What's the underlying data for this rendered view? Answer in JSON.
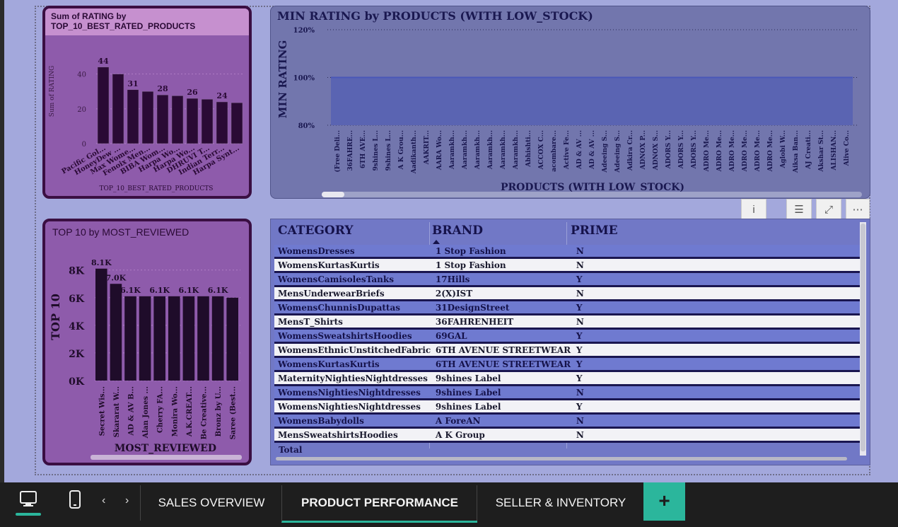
{
  "card1": {
    "title_line1": "Sum of RATING by",
    "title_line2": "TOP_10_BEST_RATED_PRODUCTS",
    "ylabel": "Sum of RATING",
    "xlabel": "TOP_10_BEST_RATED_PRODUCTS"
  },
  "card2": {
    "title": "MIN RATING by PRODUCTS (WITH LOW_STOCK)",
    "ylabel": "MIN RATING",
    "xlabel": "PRODUCTS (WITH LOW_STOCK)"
  },
  "card3": {
    "title": "TOP 10 by MOST_REVIEWED",
    "ylabel": "TOP 10",
    "xlabel": "MOST_REVIEWED"
  },
  "table": {
    "columns": [
      "CATEGORY",
      "BRAND",
      "PRIME"
    ],
    "rows": [
      [
        "WomensDresses",
        "1 Stop Fashion",
        "N"
      ],
      [
        "WomensKurtasKurtis",
        "1 Stop Fashion",
        "N"
      ],
      [
        "WomensCamisolesTanks",
        "17Hills",
        "Y"
      ],
      [
        "MensUnderwearBriefs",
        "2(X)IST",
        "N"
      ],
      [
        "WomensChunnisDupattas",
        "31DesignStreet",
        "Y"
      ],
      [
        "MensT_Shirts",
        "36FAHRENHEIT",
        "N"
      ],
      [
        "WomensSweatshirtsHoodies",
        "69GAL",
        "Y"
      ],
      [
        "WomensEthnicUnstitchedFabric",
        "6TH AVENUE STREETWEAR",
        "Y"
      ],
      [
        "WomensKurtasKurtis",
        "6TH AVENUE STREETWEAR",
        "Y"
      ],
      [
        "MaternityNightiesNightdresses",
        "9shines Label",
        "Y"
      ],
      [
        "WomensNightiesNightdresses",
        "9shines Label",
        "N"
      ],
      [
        "WomensNightiesNightdresses",
        "9shines Label",
        "Y"
      ],
      [
        "WomensBabydolls",
        "A ForeAN",
        "N"
      ],
      [
        "MensSweatshirtsHoodies",
        "A K Group",
        "N"
      ]
    ],
    "total_label": "Total"
  },
  "tabs": {
    "sales": "SALES OVERVIEW",
    "product": "PRODUCT PERFORMANCE",
    "seller": "SELLER & INVENTORY",
    "add": "+"
  },
  "chart_data": [
    {
      "type": "bar",
      "title": "Sum of RATING by TOP_10_BEST_RATED_PRODUCTS",
      "xlabel": "TOP_10_BEST_RATED_PRODUCTS",
      "ylabel": "Sum of RATING",
      "categories": [
        "Pacific Gol...",
        "HoneyDew ...",
        "Max Wome...",
        "Fenoix Men...",
        "BIBA Wom...",
        "Harpa Wo...",
        "Harpa Wo...",
        "DHRUVI T...",
        "Indian Terr...",
        "Harpa Synt..."
      ],
      "values": [
        44,
        40,
        31,
        30,
        28,
        27.5,
        26,
        25.5,
        24,
        23.5
      ],
      "data_labels": [
        "44",
        "",
        "31",
        "",
        "28",
        "",
        "26",
        "",
        "24",
        ""
      ],
      "ylim": [
        0,
        48
      ],
      "yticks": [
        "0",
        "20",
        "40"
      ],
      "bar_color": "#2a0a35"
    },
    {
      "type": "area",
      "title": "MIN RATING by PRODUCTS (WITH LOW_STOCK)",
      "xlabel": "PRODUCTS (WITH LOW_STOCK)",
      "ylabel": "MIN RATING",
      "categories": [
        "(Free Deli...",
        "36FAHRE...",
        "6TH AVE...",
        "9shines L...",
        "9shines L...",
        "A K Grou...",
        "Aadikanth...",
        "AAKRIT...",
        "AARA Wo...",
        "Aaramkh...",
        "Aaramkh...",
        "Aaramkh...",
        "Aaramkh...",
        "Aaramkh...",
        "Aaramkh...",
        "Abhishti...",
        "ACCOX C...",
        "acombare...",
        "Active Fe...",
        "AD & AV ...",
        "AD & AV ...",
        "Adeeing S...",
        "Adeeing S...",
        "Adkira Cr...",
        "ADNOX P...",
        "ADNOX S...",
        "ADORS Y...",
        "ADORS Y...",
        "ADORS Y...",
        "ADRO Me...",
        "ADRO Me...",
        "ADRO Me...",
        "ADRO Me...",
        "ADRO Me...",
        "ADRO Me...",
        "Aglobi W...",
        "Aiksa Ban...",
        "AJ Creati...",
        "Akshar St...",
        "ALISHAN...",
        "Alive Co..."
      ],
      "values": [
        100,
        100,
        100,
        100,
        100,
        100,
        100,
        100,
        100,
        100,
        100,
        100,
        100,
        100,
        100,
        100,
        100,
        100,
        100,
        100,
        100,
        100,
        100,
        100,
        100,
        100,
        100,
        100,
        100,
        100,
        100,
        100,
        100,
        100,
        100,
        100,
        100,
        100,
        100,
        100,
        100
      ],
      "yticks": [
        "80%",
        "100%",
        "120%"
      ],
      "ylim": [
        80,
        120
      ],
      "fill_color": "#5a64b2"
    },
    {
      "type": "bar",
      "title": "TOP 10 by MOST_REVIEWED",
      "xlabel": "MOST_REVIEWED",
      "ylabel": "TOP 10",
      "categories": [
        "Secret Wis...",
        "Skararat W...",
        "AD & AV B...",
        "Alan Jones ...",
        "Cherry FA...",
        "Monira Wo...",
        "A.K.CREAT...",
        "Be Creative...",
        "Bronz by U...",
        "Saree (Best..."
      ],
      "values": [
        8100,
        7000,
        6100,
        6100,
        6100,
        6100,
        6100,
        6100,
        6100,
        6000
      ],
      "data_labels": [
        "8.1K",
        "7.0K",
        "6.1K",
        "",
        "6.1K",
        "",
        "6.1K",
        "",
        "6.1K",
        ""
      ],
      "ylim": [
        0,
        8600
      ],
      "yticks": [
        "0K",
        "2K",
        "4K",
        "6K",
        "8K"
      ],
      "bar_color": "#1f0c2a"
    }
  ]
}
